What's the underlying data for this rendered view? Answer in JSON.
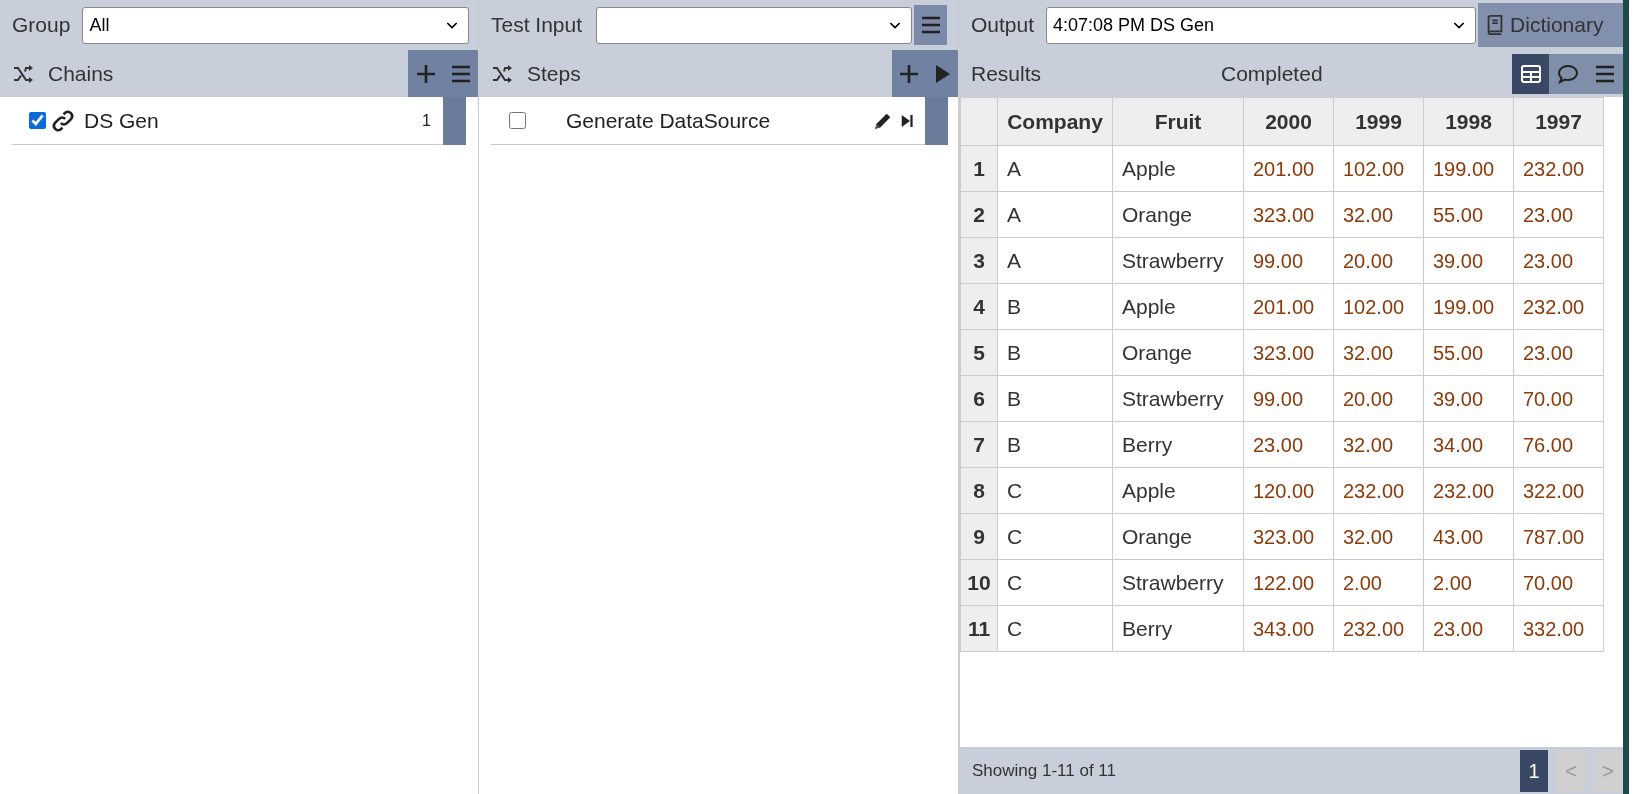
{
  "toolbar": {
    "group_label": "Group",
    "group_value": "All",
    "test_input_label": "Test Input",
    "output_label": "Output",
    "output_value": "4:07:08 PM DS Gen",
    "dictionary_button": "Dictionary"
  },
  "chains": {
    "title": "Chains",
    "items": [
      {
        "label": "DS Gen",
        "checked": true,
        "count": "1"
      }
    ]
  },
  "steps": {
    "title": "Steps",
    "items": [
      {
        "label": "Generate DataSource",
        "checked": false
      }
    ]
  },
  "results": {
    "title": "Results",
    "status": "Completed",
    "views": [
      {
        "kind": "table",
        "selected": true
      },
      {
        "kind": "comments",
        "selected": false
      },
      {
        "kind": "menu",
        "selected": false
      }
    ],
    "table": {
      "columns": [
        "Company",
        "Fruit",
        "2000",
        "1999",
        "1998",
        "1997"
      ],
      "rows": [
        {
          "number": "1",
          "cells": [
            "A",
            "Apple",
            "201.00",
            "102.00",
            "199.00",
            "232.00"
          ]
        },
        {
          "number": "2",
          "cells": [
            "A",
            "Orange",
            "323.00",
            "32.00",
            "55.00",
            "23.00"
          ]
        },
        {
          "number": "3",
          "cells": [
            "A",
            "Strawberry",
            "99.00",
            "20.00",
            "39.00",
            "23.00"
          ]
        },
        {
          "number": "4",
          "cells": [
            "B",
            "Apple",
            "201.00",
            "102.00",
            "199.00",
            "232.00"
          ]
        },
        {
          "number": "5",
          "cells": [
            "B",
            "Orange",
            "323.00",
            "32.00",
            "55.00",
            "23.00"
          ]
        },
        {
          "number": "6",
          "cells": [
            "B",
            "Strawberry",
            "99.00",
            "20.00",
            "39.00",
            "70.00"
          ]
        },
        {
          "number": "7",
          "cells": [
            "B",
            "Berry",
            "23.00",
            "32.00",
            "34.00",
            "76.00"
          ]
        },
        {
          "number": "8",
          "cells": [
            "C",
            "Apple",
            "120.00",
            "232.00",
            "232.00",
            "322.00"
          ]
        },
        {
          "number": "9",
          "cells": [
            "C",
            "Orange",
            "323.00",
            "32.00",
            "43.00",
            "787.00"
          ]
        },
        {
          "number": "10",
          "cells": [
            "C",
            "Strawberry",
            "122.00",
            "2.00",
            "2.00",
            "70.00"
          ]
        },
        {
          "number": "11",
          "cells": [
            "C",
            "Berry",
            "343.00",
            "232.00",
            "23.00",
            "332.00"
          ]
        }
      ]
    },
    "footer": {
      "summary": "Showing 1-11 of 11",
      "pages": [
        {
          "label": "1",
          "selected": true
        }
      ],
      "prev": {
        "label": "<",
        "disabled": true
      },
      "next": {
        "label": ">",
        "disabled": true
      }
    }
  }
}
